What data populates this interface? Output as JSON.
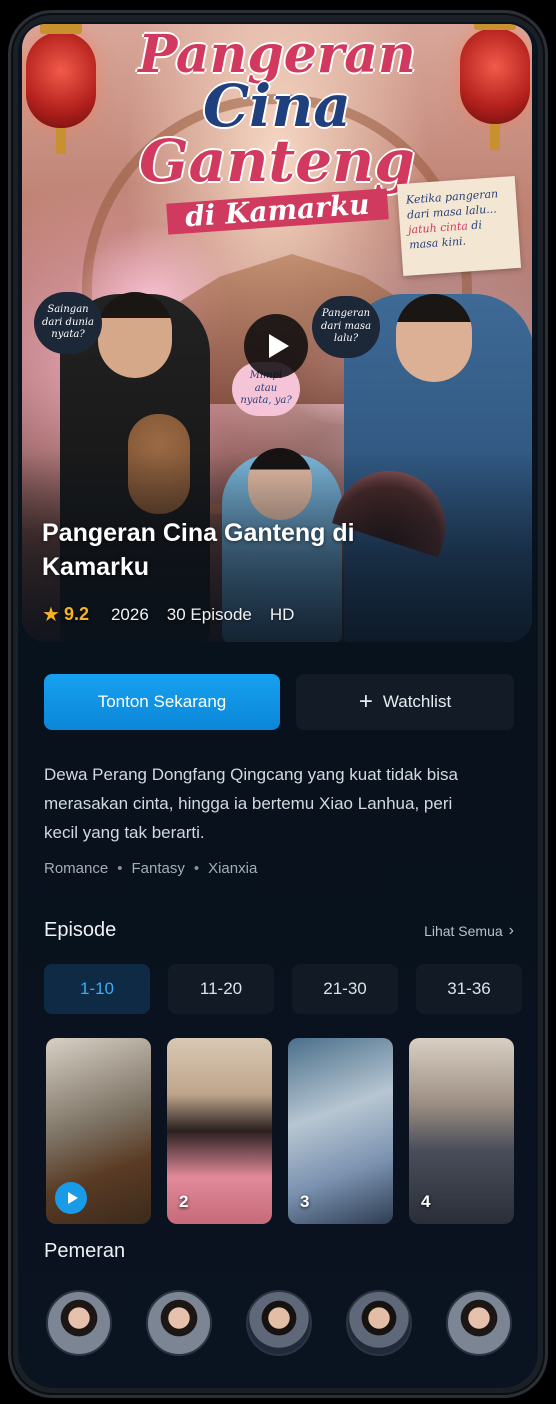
{
  "hero": {
    "poster_title_lines": [
      "Pangeran",
      "Cina",
      "Ganteng",
      "di Kamarku"
    ],
    "note": {
      "line1": "Ketika pangeran dari masa lalu...",
      "highlight": "jatuh cinta",
      "line2": "di masa kini."
    },
    "bubbles": [
      "Saingan dari dunia nyata?",
      "Pangeran dari masa lalu?",
      "Mimpi atau nyata, ya?"
    ],
    "title": "Pangeran Cina Ganteng di Kamarku",
    "rating": "9.2",
    "year": "2026",
    "episodes": "30 Episode",
    "quality": "HD"
  },
  "actions": {
    "watch_label": "Tonton Sekarang",
    "watchlist_label": "Watchlist"
  },
  "description": "Dewa Perang Dongfang Qingcang yang kuat tidak bisa merasakan cinta, hingga ia bertemu Xiao Lanhua, peri kecil yang tak berarti.",
  "genres": [
    "Romance",
    "Fantasy",
    "Xianxia"
  ],
  "episode_section": {
    "title": "Episode",
    "see_all": "Lihat Semua",
    "tabs": [
      {
        "label": "1-10",
        "active": true
      },
      {
        "label": "11-20",
        "active": false
      },
      {
        "label": "21-30",
        "active": false
      },
      {
        "label": "31-36",
        "active": false
      }
    ],
    "thumbnails": [
      {
        "number": "",
        "playing": true
      },
      {
        "number": "2"
      },
      {
        "number": "3"
      },
      {
        "number": "4"
      }
    ]
  },
  "cast_section": {
    "title": "Pemeran",
    "count": 5
  },
  "colors": {
    "accent": "#17a1f0",
    "rating": "#f5b324",
    "background": "#08111c"
  }
}
